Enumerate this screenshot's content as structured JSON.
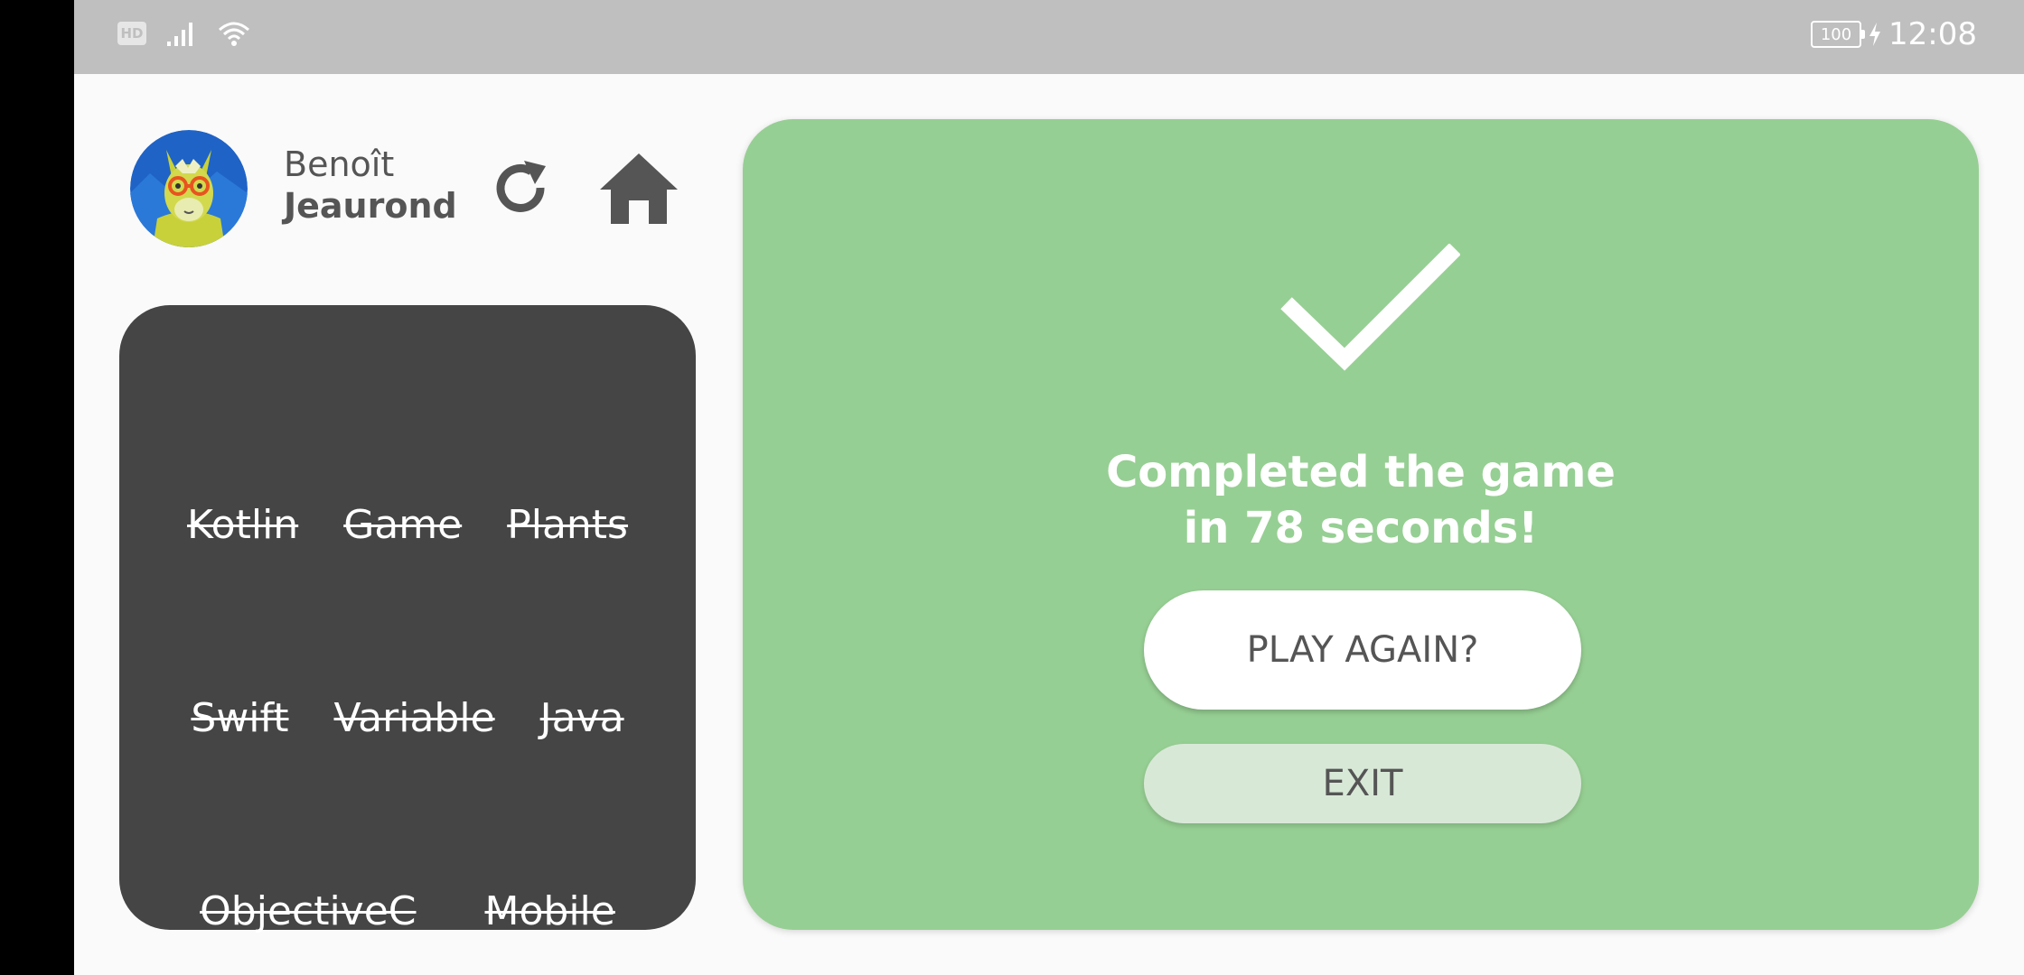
{
  "status_bar": {
    "hd_label": "HD",
    "battery_level": "100",
    "time": "12:08",
    "icons": [
      "hd-icon",
      "signal-icon",
      "wifi-icon",
      "battery-icon",
      "charging-icon"
    ]
  },
  "header": {
    "first_name": "Benoît",
    "last_name": "Jeaurond",
    "avatar": "llama-avatar",
    "actions": [
      "refresh-icon",
      "home-icon"
    ]
  },
  "words": {
    "rows": [
      [
        "Kotlin",
        "Game",
        "Plants"
      ],
      [
        "Swift",
        "Variable",
        "Java"
      ],
      [
        "ObjectiveC",
        "Mobile"
      ]
    ],
    "state": "all-found"
  },
  "result": {
    "icon": "checkmark-icon",
    "message": "Completed the game in 78 seconds!",
    "play_again_label": "PLAY AGAIN?",
    "exit_label": "EXIT"
  },
  "colors": {
    "card_green": "#96cf93",
    "word_panel": "#454545",
    "status_bar": "#bfbfbf",
    "icon_grey": "#555555",
    "exit_button": "#d8e8d7"
  }
}
